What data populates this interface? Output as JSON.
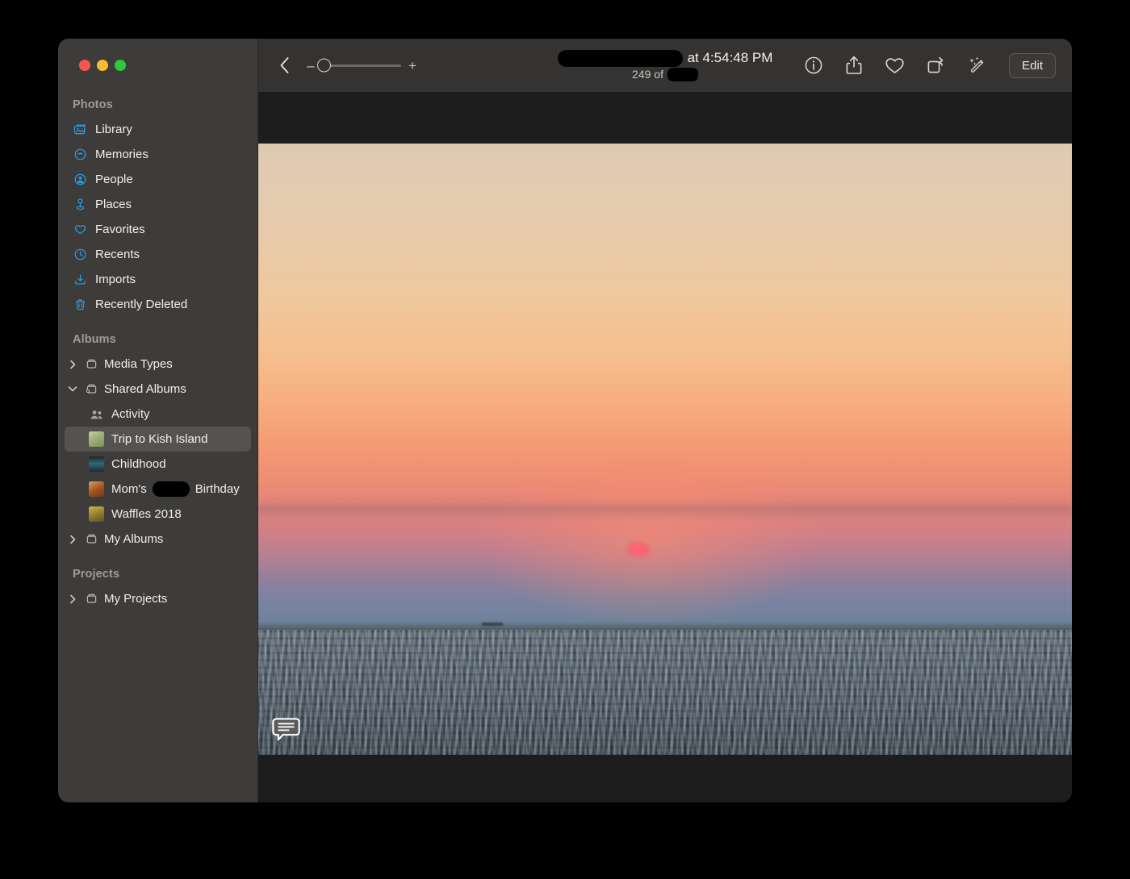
{
  "window": {
    "traffic_lights": [
      {
        "name": "close",
        "color": "#f9564f"
      },
      {
        "name": "minimize",
        "color": "#f8bd2e"
      },
      {
        "name": "maximize",
        "color": "#2fc83c"
      }
    ]
  },
  "sidebar": {
    "sections": [
      {
        "header": "Photos",
        "items": [
          {
            "label": "Library",
            "icon": "library-icon"
          },
          {
            "label": "Memories",
            "icon": "memories-icon"
          },
          {
            "label": "People",
            "icon": "people-icon"
          },
          {
            "label": "Places",
            "icon": "places-icon"
          },
          {
            "label": "Favorites",
            "icon": "heart-icon"
          },
          {
            "label": "Recents",
            "icon": "clock-icon"
          },
          {
            "label": "Imports",
            "icon": "import-icon"
          },
          {
            "label": "Recently Deleted",
            "icon": "trash-icon"
          }
        ]
      },
      {
        "header": "Albums",
        "items": [
          {
            "label": "Media Types",
            "icon": "folder-icon",
            "disclosure": "collapsed"
          },
          {
            "label": "Shared Albums",
            "icon": "shared-folder-icon",
            "disclosure": "expanded"
          },
          {
            "label": "Activity",
            "icon": "activity-people-icon",
            "indent": true
          },
          {
            "label": "Trip to Kish Island",
            "icon": "album-thumbnail",
            "indent": true,
            "selected": true
          },
          {
            "label": "Childhood",
            "icon": "album-thumbnail",
            "indent": true
          },
          {
            "label": "Mom's ███ Birthday",
            "icon": "album-thumbnail",
            "indent": true,
            "redacted": true
          },
          {
            "label": "Waffles 2018",
            "icon": "album-thumbnail",
            "indent": true
          },
          {
            "label": "My Albums",
            "icon": "folder-icon",
            "disclosure": "collapsed"
          }
        ]
      },
      {
        "header": "Projects",
        "items": [
          {
            "label": "My Projects",
            "icon": "folder-icon",
            "disclosure": "collapsed"
          }
        ]
      }
    ],
    "labels": {
      "photos": "Photos",
      "albums": "Albums",
      "projects": "Projects",
      "library": "Library",
      "memories": "Memories",
      "people": "People",
      "places": "Places",
      "favorites": "Favorites",
      "recents": "Recents",
      "imports": "Imports",
      "recently_deleted": "Recently Deleted",
      "media_types": "Media Types",
      "shared_albums": "Shared Albums",
      "activity": "Activity",
      "trip_to_kish_island": "Trip to Kish Island",
      "childhood": "Childhood",
      "moms_birthday_prefix": "Mom's",
      "moms_birthday_suffix": "Birthday",
      "waffles_2018": "Waffles 2018",
      "my_albums": "My Albums",
      "my_projects": "My Projects"
    }
  },
  "toolbar": {
    "back_icon": "chevron-left-icon",
    "zoom": {
      "minus_label": "–",
      "plus_label": "+",
      "value_percent": 0
    },
    "title_time": "at 4:54:48 PM",
    "subtitle_count": "249 of",
    "title_redacted": true,
    "subtitle_redacted": true,
    "actions": [
      {
        "name": "info-icon",
        "label": "Info"
      },
      {
        "name": "share-icon",
        "label": "Share"
      },
      {
        "name": "heart-icon",
        "label": "Favorite"
      },
      {
        "name": "rotate-icon",
        "label": "Rotate"
      },
      {
        "name": "auto-enhance-icon",
        "label": "Auto Enhance"
      }
    ],
    "edit_label": "Edit"
  },
  "photo": {
    "description": "Sunset over the sea",
    "comment_badge_icon": "comment-bubble-icon",
    "colors": {
      "sky_top": "#dfc9b2",
      "sky_glow": "#f7b181",
      "horizon": "#7e82a0",
      "sun": "#fa5f72",
      "water": "#4d5a64"
    }
  }
}
